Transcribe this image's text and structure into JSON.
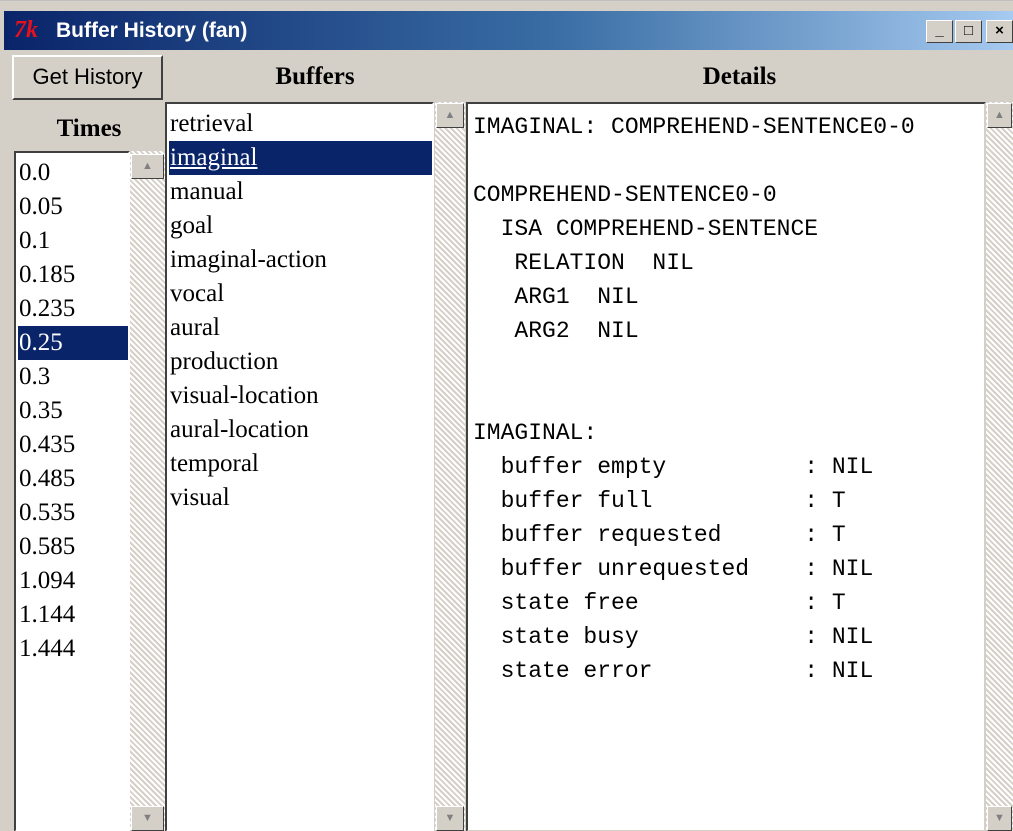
{
  "window": {
    "title": "Buffer History (fan)",
    "controls": {
      "minimize": "_",
      "maximize": "□",
      "close": "×"
    }
  },
  "toolbar": {
    "get_history_label": "Get History"
  },
  "headers": {
    "times": "Times",
    "buffers": "Buffers",
    "details": "Details"
  },
  "times": {
    "selected": "0.25",
    "items": [
      "0.0",
      "0.05",
      "0.1",
      "0.185",
      "0.235",
      "0.25",
      "0.3",
      "0.35",
      "0.435",
      "0.485",
      "0.535",
      "0.585",
      "1.094",
      "1.144",
      "1.444"
    ]
  },
  "buffers": {
    "selected": "imaginal",
    "items": [
      "retrieval",
      "imaginal",
      "manual",
      "goal",
      "imaginal-action",
      "vocal",
      "aural",
      "production",
      "visual-location",
      "aural-location",
      "temporal",
      "visual"
    ]
  },
  "details": {
    "lines": [
      "IMAGINAL: COMPREHEND-SENTENCE0-0",
      "",
      "COMPREHEND-SENTENCE0-0",
      "  ISA COMPREHEND-SENTENCE",
      "   RELATION  NIL",
      "   ARG1  NIL",
      "   ARG2  NIL",
      "",
      "",
      "IMAGINAL:",
      "  buffer empty          : NIL",
      "  buffer full           : T",
      "  buffer requested      : T",
      "  buffer unrequested    : NIL",
      "  state free            : T",
      "  state busy            : NIL",
      "  state error           : NIL"
    ]
  },
  "scrollbar": {
    "up_arrow": "▲",
    "down_arrow": "▼"
  },
  "colors": {
    "selection": "#0a246a",
    "titlebar_start": "#0a246a",
    "titlebar_end": "#a6caf0",
    "tk_icon": "#e8101a"
  },
  "icons": {
    "app": "tk-feather-icon"
  }
}
